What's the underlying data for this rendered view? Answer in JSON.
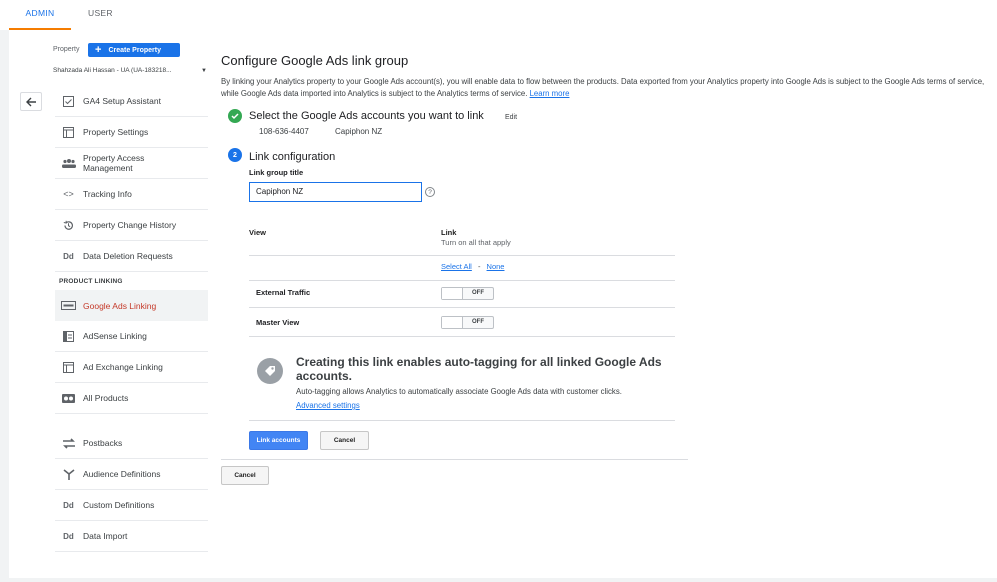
{
  "tabs": {
    "admin": "ADMIN",
    "user": "USER"
  },
  "property": {
    "label": "Property",
    "create_button": "Create Property",
    "account": "Shahzada Ali Hassan - UA (UA-183218..."
  },
  "nav": {
    "items": [
      {
        "label": "GA4 Setup Assistant",
        "icon": "checkbox-icon"
      },
      {
        "label": "Property Settings",
        "icon": "window-icon"
      },
      {
        "label": "Property Access Management",
        "icon": "people-icon"
      },
      {
        "label": "Tracking Info",
        "icon": "code-icon"
      },
      {
        "label": "Property Change History",
        "icon": "history-icon"
      },
      {
        "label": "Data Deletion Requests",
        "icon": "dd-icon"
      }
    ],
    "section_label": "PRODUCT LINKING",
    "linking": [
      {
        "label": "Google Ads Linking",
        "icon": "ads-icon"
      },
      {
        "label": "AdSense Linking",
        "icon": "adsense-icon"
      },
      {
        "label": "Ad Exchange Linking",
        "icon": "adexchange-icon"
      },
      {
        "label": "All Products",
        "icon": "products-icon"
      }
    ],
    "other": [
      {
        "label": "Postbacks",
        "icon": "postbacks-icon"
      },
      {
        "label": "Audience Definitions",
        "icon": "audience-icon"
      },
      {
        "label": "Custom Definitions",
        "icon": "dd-icon"
      },
      {
        "label": "Data Import",
        "icon": "dd-icon"
      }
    ]
  },
  "main": {
    "title": "Configure Google Ads link group",
    "description": "By linking your Analytics property to your Google Ads account(s), you will enable data to flow between the products. Data exported from your Analytics property into Google Ads is subject to the Google Ads terms of service, while Google Ads data imported into Analytics is subject to the Analytics terms of service.",
    "learn_more": "Learn more",
    "step1": {
      "title": "Select the Google Ads accounts you want to link",
      "edit": "Edit",
      "account_id": "108-636-4407",
      "account_name": "Capiphon NZ"
    },
    "step2": {
      "number": "2",
      "title": "Link configuration",
      "group_title_label": "Link group title",
      "group_title_value": "Capiphon NZ",
      "help": "?"
    },
    "table": {
      "view_header": "View",
      "link_header": "Link",
      "link_sub": "Turn on all that apply",
      "select_all": "Select All",
      "separator": "-",
      "none": "None",
      "rows": [
        {
          "label": "External Traffic",
          "toggle": "OFF"
        },
        {
          "label": "Master View",
          "toggle": "OFF"
        }
      ]
    },
    "autotag": {
      "title": "Creating this link enables auto-tagging for all linked Google Ads accounts.",
      "description": "Auto-tagging allows Analytics to automatically associate Google Ads data with customer clicks.",
      "advanced": "Advanced settings"
    },
    "buttons": {
      "link_accounts": "Link accounts",
      "cancel": "Cancel",
      "cancel_outer": "Cancel"
    }
  },
  "colors": {
    "accent": "#1a73e8",
    "active_text": "#c53929",
    "tab_underline": "#f57c00",
    "success": "#34a853"
  }
}
